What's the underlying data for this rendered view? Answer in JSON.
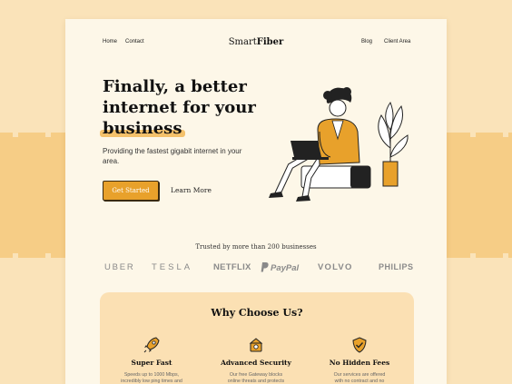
{
  "nav": {
    "home": "Home",
    "contact": "Contact",
    "logo_light": "Smart",
    "logo_bold": "Fiber",
    "blog": "Blog",
    "client_area": "Client Area"
  },
  "hero": {
    "title_line1": "Finally, a better",
    "title_line2": "internet for your",
    "title_highlight": "business",
    "subtitle": "Providing the fastest gigabit internet in your area.",
    "cta_primary": "Get Started",
    "cta_secondary": "Learn More"
  },
  "trusted": {
    "label": "Trusted by more than 200 businesses",
    "brands": [
      "UBER",
      "TESLA",
      "NETFLIX",
      "PayPal",
      "VOLVO",
      "PHILIPS"
    ]
  },
  "why": {
    "title": "Why Choose Us?",
    "features": [
      {
        "title": "Super Fast",
        "desc_line1": "Speeds up to 1000 Mbps,",
        "desc_line2": "incredibly low ping times and",
        "icon": "rocket-icon"
      },
      {
        "title": "Advanced Security",
        "desc_line1": "Our free Gateway blocks",
        "desc_line2": "online threats and protects",
        "icon": "guard-icon"
      },
      {
        "title": "No Hidden Fees",
        "desc_line1": "Our services are offered",
        "desc_line2": "with no contract and no",
        "icon": "shield-check-icon"
      }
    ]
  },
  "colors": {
    "accent": "#e8a12b",
    "page_bg": "#fdf7e8",
    "outer_bg": "#fae3b9",
    "band": "#f6cd86",
    "section_bg": "#fbe0b3"
  }
}
